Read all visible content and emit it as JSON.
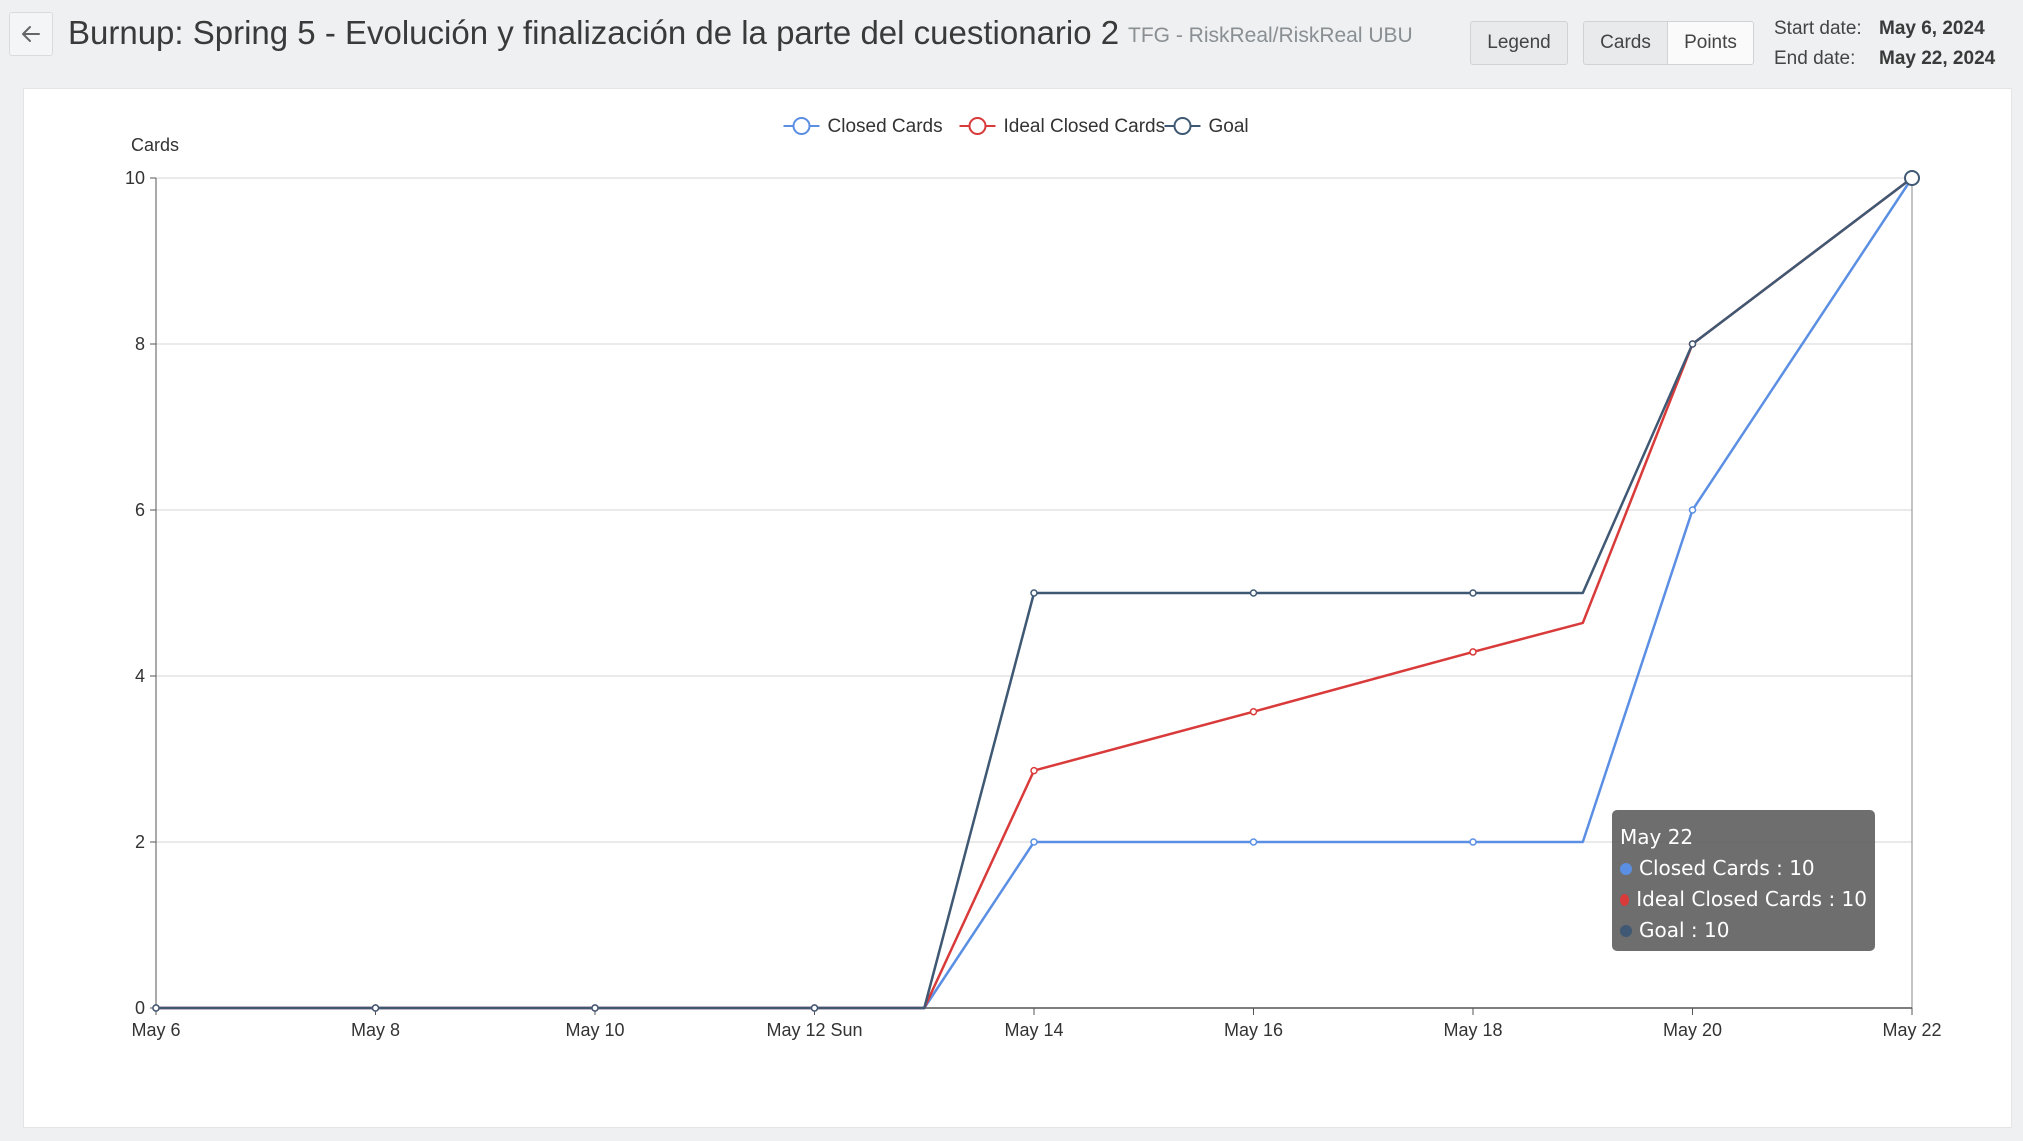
{
  "header": {
    "title": "Burnup: Spring 5 - Evolución y finalización de la parte del cuestionario 2",
    "breadcrumb": "TFG - RiskReal/RiskReal UBU",
    "legend_label": "Legend",
    "cards_label": "Cards",
    "points_label": "Points",
    "start_label": "Start date:",
    "start_value": "May 6, 2024",
    "end_label": "End date:",
    "end_value": "May 22, 2024"
  },
  "icons": {
    "back": "arrow-left-icon"
  },
  "chart_data": {
    "type": "line",
    "ylabel": "Cards",
    "ylim": [
      0,
      10
    ],
    "yticks": [
      0,
      2,
      4,
      6,
      8,
      10
    ],
    "xlim": [
      0,
      16
    ],
    "xticks": [
      {
        "x": 0,
        "label": "May 6"
      },
      {
        "x": 2,
        "label": "May 8"
      },
      {
        "x": 4,
        "label": "May 10"
      },
      {
        "x": 6,
        "label": "May 12 Sun"
      },
      {
        "x": 8,
        "label": "May 14"
      },
      {
        "x": 10,
        "label": "May 16"
      },
      {
        "x": 12,
        "label": "May 18"
      },
      {
        "x": 14,
        "label": "May 20"
      },
      {
        "x": 16,
        "label": "May 22"
      }
    ],
    "legend_position": "top-center",
    "grid": "horizontal",
    "series": [
      {
        "name": "Closed Cards",
        "color": "#5b8fe3",
        "points": [
          [
            0,
            0
          ],
          [
            2,
            0
          ],
          [
            4,
            0
          ],
          [
            6,
            0
          ],
          [
            7,
            0
          ],
          [
            8,
            2
          ],
          [
            10,
            2
          ],
          [
            12,
            2
          ],
          [
            13,
            2
          ],
          [
            14,
            6
          ],
          [
            16,
            10
          ]
        ]
      },
      {
        "name": "Ideal Closed Cards",
        "color": "#d93a3a",
        "points": [
          [
            0,
            0
          ],
          [
            2,
            0
          ],
          [
            4,
            0
          ],
          [
            6,
            0
          ],
          [
            7,
            0
          ],
          [
            8,
            2.86
          ],
          [
            10,
            3.57
          ],
          [
            12,
            4.29
          ],
          [
            13,
            4.64
          ],
          [
            14,
            8
          ],
          [
            16,
            10
          ]
        ]
      },
      {
        "name": "Goal",
        "color": "#3f5873",
        "points": [
          [
            0,
            0
          ],
          [
            2,
            0
          ],
          [
            4,
            0
          ],
          [
            6,
            0
          ],
          [
            7,
            0
          ],
          [
            8,
            5
          ],
          [
            10,
            5
          ],
          [
            12,
            5
          ],
          [
            13,
            5
          ],
          [
            14,
            8
          ],
          [
            16,
            10
          ]
        ]
      }
    ],
    "markers": [
      0,
      2,
      4,
      6,
      8,
      10,
      12,
      14,
      16
    ],
    "highlight_x": 16
  },
  "tooltip": {
    "title": "May 22",
    "rows": [
      {
        "text": "Closed Cards : 10",
        "color": "#5b8fe3"
      },
      {
        "text": "Ideal Closed Cards : 10",
        "color": "#d93a3a"
      },
      {
        "text": "Goal : 10",
        "color": "#3f5873"
      }
    ]
  }
}
